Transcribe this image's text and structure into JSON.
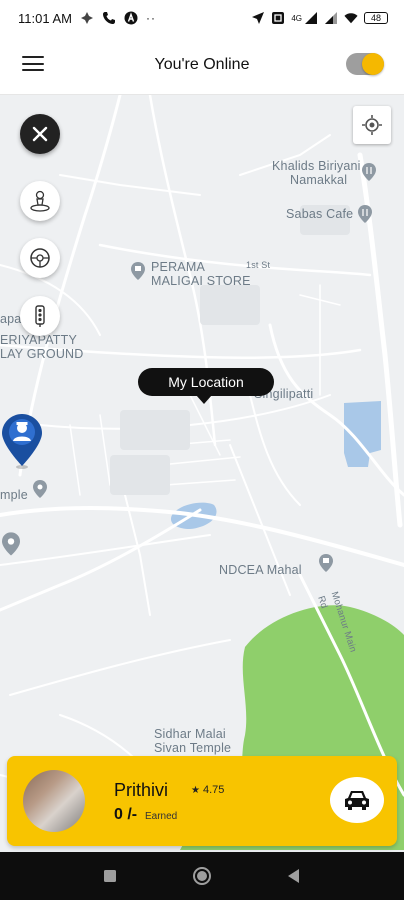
{
  "status_bar": {
    "time": "11:01 AM",
    "network": "4G",
    "battery": "48"
  },
  "header": {
    "title": "You're Online",
    "online_toggle": true
  },
  "map": {
    "labels": [
      {
        "text": "Khalids Biriyani",
        "key": "khalids1"
      },
      {
        "text": "Namakkal",
        "key": "khalids2"
      },
      {
        "text": "Sabas Cafe",
        "key": "sabas"
      },
      {
        "text": "PERAMA",
        "key": "perama1"
      },
      {
        "text": "MALIGAI STORE",
        "key": "perama2"
      },
      {
        "text": "1st St",
        "key": "firstst"
      },
      {
        "text": "apa",
        "key": "apa"
      },
      {
        "text": "ERIYAPATTY",
        "key": "eri1"
      },
      {
        "text": "LAY GROUND",
        "key": "eri2"
      },
      {
        "text": "Singilipatti",
        "key": "singili"
      },
      {
        "text": "mple",
        "key": "mple"
      },
      {
        "text": "NDCEA Mahal",
        "key": "ndcea"
      },
      {
        "text": "Sidhar Malai",
        "key": "sidhar1"
      },
      {
        "text": "Sivan Temple",
        "key": "sidhar2"
      },
      {
        "text": "Mohanur Main Rd",
        "key": "mohanur"
      }
    ],
    "marker_label": "My Location"
  },
  "driver": {
    "name": "Prithivi",
    "rating": "4.75",
    "earned_amount": "0 /-",
    "earned_label": "Earned"
  },
  "colors": {
    "accent": "#f8c400",
    "marker": "#1a4fa0",
    "park": "#8fcf6b",
    "water": "#a9c8e8"
  },
  "icons": [
    "menu-icon",
    "close-icon",
    "heatmap-icon",
    "steering-icon",
    "traffic-light-icon",
    "my-location-icon",
    "car-icon",
    "driver-pin-icon"
  ]
}
